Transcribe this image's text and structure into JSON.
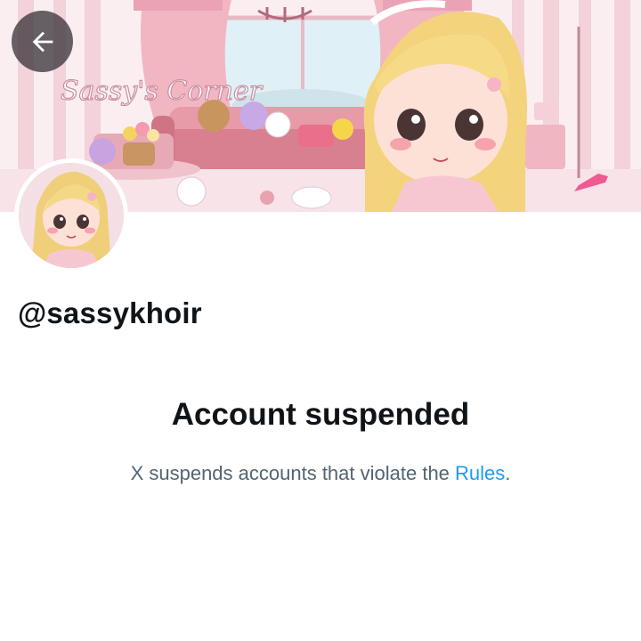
{
  "header": {
    "back_icon": "arrow-left-icon",
    "banner_text": "Sassy's Corner"
  },
  "profile": {
    "handle": "@sassykhoir"
  },
  "notice": {
    "title": "Account suspended",
    "text_before": "X suspends accounts that violate the ",
    "link_text": "Rules",
    "text_after": "."
  },
  "colors": {
    "link": "#1d9bf0",
    "secondary_text": "#536471",
    "primary_text": "#0f1419",
    "banner_pink": "#f4c9d3"
  }
}
